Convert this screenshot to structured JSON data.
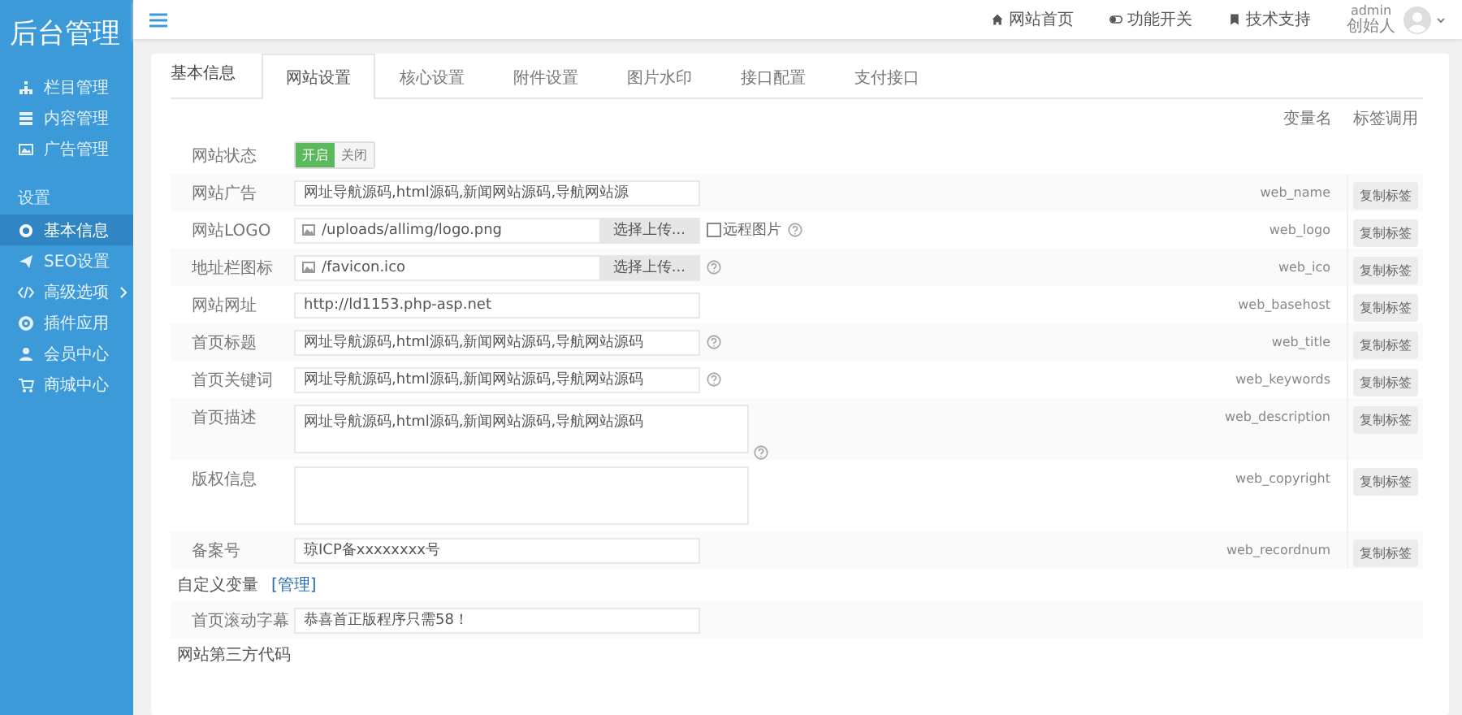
{
  "sidebar": {
    "logo": "后台管理",
    "items": [
      {
        "kind": "item",
        "label": "栏目管理",
        "selected": false,
        "expandable": false
      },
      {
        "kind": "item",
        "label": "内容管理",
        "selected": false,
        "expandable": false
      },
      {
        "kind": "item",
        "label": "广告管理",
        "selected": false,
        "expandable": false
      },
      {
        "kind": "section",
        "label": "设置"
      },
      {
        "kind": "item",
        "label": "基本信息",
        "selected": true,
        "expandable": false
      },
      {
        "kind": "item",
        "label": "SEO设置",
        "selected": false,
        "expandable": false
      },
      {
        "kind": "item",
        "label": "高级选项",
        "selected": false,
        "expandable": true
      },
      {
        "kind": "item",
        "label": "插件应用",
        "selected": false,
        "expandable": false
      },
      {
        "kind": "item",
        "label": "会员中心",
        "selected": false,
        "expandable": false
      },
      {
        "kind": "item",
        "label": "商城中心",
        "selected": false,
        "expandable": false
      }
    ]
  },
  "top_bar": {
    "links": [
      "网站首页",
      "功能开关",
      "技术支持"
    ],
    "user": {
      "name": "admin",
      "role": "创始人"
    }
  },
  "section_title": "基本信息",
  "tabs": [
    {
      "label": "网站设置",
      "selected": true
    },
    {
      "label": "核心设置",
      "selected": false
    },
    {
      "label": "附件设置",
      "selected": false
    },
    {
      "label": "图片水印",
      "selected": false
    },
    {
      "label": "接口配置",
      "selected": false
    },
    {
      "label": "支付接口",
      "selected": false
    }
  ],
  "columns": [
    "变量名",
    "标签调用"
  ],
  "fields": [
    {
      "kind": "toggle",
      "label": "网站状态",
      "options": [
        {
          "label": "开启",
          "selected": true
        },
        {
          "label": "关闭",
          "selected": false
        }
      ]
    },
    {
      "kind": "text",
      "label": "网站广告",
      "value": "网址导航源码,html源码,新闻网站源码,导航网站源",
      "help": false,
      "variable": "web_name",
      "button": "复制标签"
    },
    {
      "kind": "file",
      "label": "网站LOGO",
      "value": "/uploads/allimg/logo.png",
      "upload": "选择上传...",
      "remote": {
        "label": "远程图片",
        "checked": false
      },
      "help": true,
      "variable": "web_logo",
      "button": "复制标签"
    },
    {
      "kind": "file",
      "label": "地址栏图标",
      "value": "/favicon.ico",
      "upload": "选择上传...",
      "help": true,
      "variable": "web_ico",
      "button": "复制标签"
    },
    {
      "kind": "text",
      "label": "网站网址",
      "value": "http://ld1153.php-asp.net",
      "help": false,
      "variable": "web_basehost",
      "button": "复制标签"
    },
    {
      "kind": "text",
      "label": "首页标题",
      "value": "网址导航源码,html源码,新闻网站源码,导航网站源码",
      "help": true,
      "variable": "web_title",
      "button": "复制标签"
    },
    {
      "kind": "text",
      "label": "首页关键词",
      "value": "网址导航源码,html源码,新闻网站源码,导航网站源码",
      "help": true,
      "variable": "web_keywords",
      "button": "复制标签"
    },
    {
      "kind": "textarea",
      "label": "首页描述",
      "value": "网址导航源码,html源码,新闻网站源码,导航网站源码",
      "help": true,
      "variable": "web_description",
      "button": "复制标签"
    },
    {
      "kind": "textarea",
      "label": "版权信息",
      "help": false,
      "variable": "web_copyright",
      "button": "复制标签"
    },
    {
      "kind": "text",
      "label": "备案号",
      "value": "琼ICP备xxxxxxxx号",
      "help": false,
      "variable": "web_recordnum",
      "button": "复制标签"
    },
    {
      "kind": "heading",
      "label": "自定义变量",
      "link": "[管理]"
    },
    {
      "kind": "text",
      "label": "首页滚动字幕",
      "value": "恭喜首正版程序只需58！",
      "help": false
    },
    {
      "kind": "heading",
      "label": "网站第三方代码"
    }
  ]
}
